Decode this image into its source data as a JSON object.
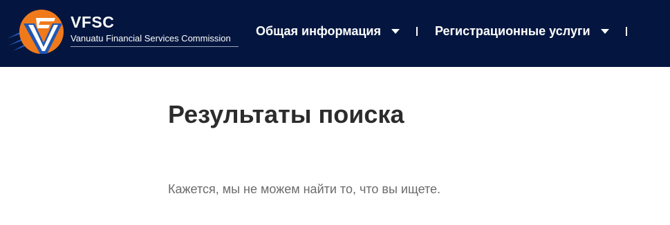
{
  "header": {
    "logo": {
      "title": "VFSC",
      "subtitle": "Vanuatu Financial Services Commission",
      "colors": {
        "orange": "#f07a1b",
        "blue": "#1f57b5",
        "white": "#ffffff"
      }
    },
    "nav": [
      {
        "label": "Общая информация",
        "icon": "caret-down-icon"
      },
      {
        "label": "Регистрационные услуги",
        "icon": "caret-down-icon"
      }
    ],
    "background": "#04163f"
  },
  "main": {
    "title": "Результаты поиска",
    "message": "Кажется, мы не можем найти то, что вы ищете."
  }
}
